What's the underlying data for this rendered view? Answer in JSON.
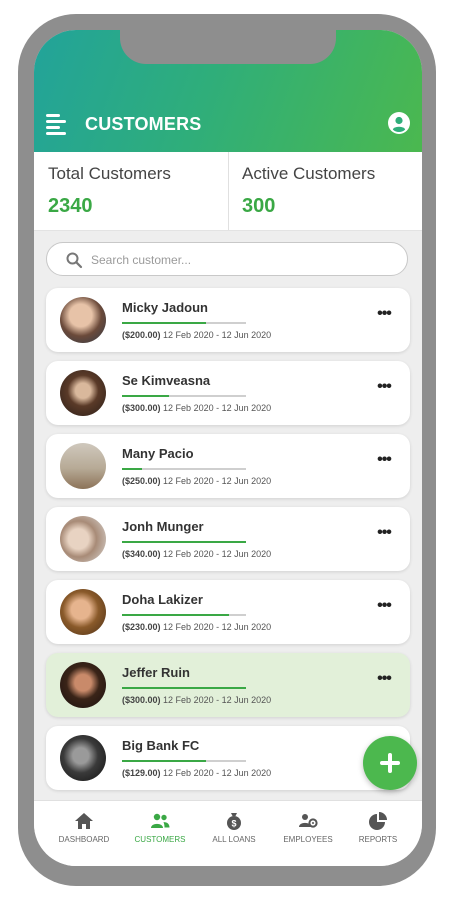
{
  "header": {
    "title": "CUSTOMERS"
  },
  "stats": {
    "total_label": "Total Customers",
    "total_value": "2340",
    "active_label": "Active Customers",
    "active_value": "300"
  },
  "search": {
    "placeholder": "Search customer..."
  },
  "customers": [
    {
      "name": "Micky Jadoun",
      "amount": "($200.00)",
      "dates": "12 Feb 2020 - 12 Jun 2020",
      "progress": 0.68
    },
    {
      "name": "Se Kimveasna",
      "amount": "($300.00)",
      "dates": "12 Feb 2020 - 12 Jun 2020",
      "progress": 0.38
    },
    {
      "name": "Many Pacio",
      "amount": "($250.00)",
      "dates": "12 Feb 2020 - 12 Jun 2020",
      "progress": 0.16
    },
    {
      "name": "Jonh Munger",
      "amount": "($340.00)",
      "dates": "12 Feb 2020 - 12 Jun 2020",
      "progress": 1.0
    },
    {
      "name": "Doha Lakizer",
      "amount": "($230.00)",
      "dates": "12 Feb 2020 - 12 Jun 2020",
      "progress": 0.86
    },
    {
      "name": "Jeffer Ruin",
      "amount": "($300.00)",
      "dates": "12 Feb 2020 - 12 Jun 2020",
      "progress": 1.0
    },
    {
      "name": "Big Bank FC",
      "amount": "($129.00)",
      "dates": "12 Feb 2020 - 12 Jun 2020",
      "progress": 0.68
    }
  ],
  "bottom_nav": [
    {
      "label": "DASHBOARD",
      "icon": "home-icon"
    },
    {
      "label": "CUSTOMERS",
      "icon": "users-icon"
    },
    {
      "label": "ALL LOANS",
      "icon": "money-bag-icon"
    },
    {
      "label": "EMPLOYEES",
      "icon": "employees-icon"
    },
    {
      "label": "REPORTS",
      "icon": "pie-chart-icon"
    }
  ],
  "colors": {
    "accent": "#3aa845",
    "header_start": "#22a39a",
    "header_end": "#4bb84f",
    "highlight_row": "#e2f0d9"
  }
}
